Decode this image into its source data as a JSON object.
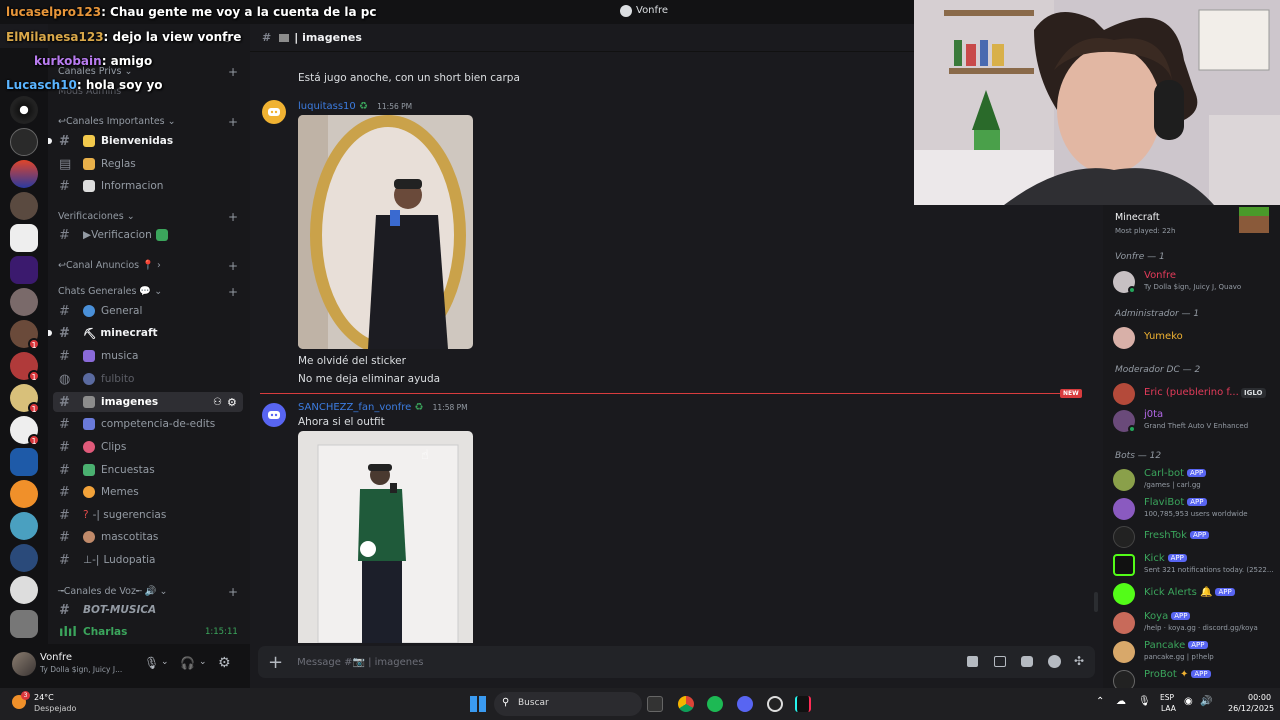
{
  "window": {
    "title": "Vonfre"
  },
  "overlay": [
    {
      "user": "lucaselpro123",
      "text": ": Chau gente me voy a la cuenta de la pc"
    },
    {
      "user": "ElMilanesa123",
      "text": ": dejo la view vonfre"
    },
    {
      "user": "kurkobain",
      "text": ": amigo"
    },
    {
      "user": "Lucasch10",
      "text": ": hola soy yo"
    }
  ],
  "server": {
    "name_partial": "Mods Admins"
  },
  "categories": {
    "privs": "Canales Privs",
    "importantes": "Canales Importantes",
    "verificaciones": "Verificaciones",
    "anuncios": "Canal Anuncios",
    "generales": "Chats Generales",
    "voz": "Canales de Voz"
  },
  "channels": [
    {
      "name": "Bienvenidas",
      "icon": "wave-icon",
      "style": "bold"
    },
    {
      "name": "Reglas",
      "icon": "scroll-icon",
      "style": ""
    },
    {
      "name": "Informacion",
      "icon": "page-icon",
      "style": ""
    },
    {
      "name": "▶Verificacion",
      "icon": "check-icon",
      "style": ""
    },
    {
      "name": "General",
      "icon": "globe-icon",
      "style": ""
    },
    {
      "name": "minecraft",
      "icon": "pickaxe-icon",
      "style": "bold"
    },
    {
      "name": "musica",
      "icon": "music-icon",
      "style": ""
    },
    {
      "name": "fulbito",
      "icon": "ball-icon",
      "style": "muted"
    },
    {
      "name": "imagenes",
      "icon": "camera-icon",
      "style": "active"
    },
    {
      "name": "competencia-de-edits",
      "icon": "film-icon",
      "style": ""
    },
    {
      "name": "Clips",
      "icon": "clip-icon",
      "style": ""
    },
    {
      "name": "Encuestas",
      "icon": "chart-icon",
      "style": ""
    },
    {
      "name": "Memes",
      "icon": "laugh-icon",
      "style": ""
    },
    {
      "name": "sugerencias",
      "icon": "question-icon",
      "style": ""
    },
    {
      "name": "mascotitas",
      "icon": "pet-icon",
      "style": ""
    },
    {
      "name": "Ludopatia",
      "icon": "dice-icon",
      "style": ""
    }
  ],
  "voice": {
    "bot": "BOT-MUSICA",
    "charlas": "Charlas",
    "time": "1:15:11"
  },
  "user_panel": {
    "name": "Vonfre",
    "status": "Ty Dolla $ign, Juicy J..."
  },
  "chat": {
    "channel": "imagenes",
    "messages": [
      {
        "text": "Está jugo anoche, con un short bien carpa"
      },
      {
        "user": "luquitass10",
        "time": "11:56 PM"
      },
      {
        "text": "Me olvidé del sticker"
      },
      {
        "text": "No me deja eliminar ayuda"
      },
      {
        "user": "SANCHEZZ_fan_vonfre",
        "time": "11:58 PM",
        "text": "Ahora si el outfit"
      }
    ],
    "new_label": "NEW",
    "placeholder": "Message #📷 | imagenes"
  },
  "members": {
    "top_game": "Minecraft",
    "top_game_sub": "Most played: 22h",
    "groups": [
      {
        "role": "Vonfre — 1"
      },
      {
        "role": "Administrador — 1"
      },
      {
        "role": "Moderador DC — 2"
      },
      {
        "role": "Bots — 12"
      }
    ],
    "list": [
      {
        "name": "Vonfre",
        "sub": "Ty Dolla $ign, Juicy J, Quavo",
        "color": "#e23b5a"
      },
      {
        "name": "Yumeko",
        "sub": "",
        "color": "#f0b232"
      },
      {
        "name": "Eric (pueblerino f...",
        "sub": "",
        "color": "#e23b5a",
        "tag": "IGLO"
      },
      {
        "name": "j0ta",
        "sub": "Grand Theft Auto V Enhanced",
        "color": "#b267e6"
      },
      {
        "name": "Carl-bot",
        "sub": "/games | carl.gg",
        "color": "#3ba55c",
        "app": "APP"
      },
      {
        "name": "FlaviBot",
        "sub": "100,785,953 users worldwide",
        "color": "#3ba55c",
        "app": "APP"
      },
      {
        "name": "FreshTok",
        "sub": "",
        "color": "#3ba55c",
        "app": "APP"
      },
      {
        "name": "Kick",
        "sub": "Sent 321 notifications today. (2522...",
        "color": "#3ba55c",
        "app": "APP"
      },
      {
        "name": "Kick Alerts",
        "sub": "",
        "color": "#3ba55c",
        "app": "APP"
      },
      {
        "name": "Koya",
        "sub": "/help · koya.gg · discord.gg/koya",
        "color": "#3ba55c",
        "app": "APP"
      },
      {
        "name": "Pancake",
        "sub": "pancake.gg | p!help",
        "color": "#3ba55c",
        "app": "APP"
      },
      {
        "name": "ProBot",
        "sub": "",
        "color": "#3ba55c",
        "app": "APP"
      }
    ]
  },
  "taskbar": {
    "weather_temp": "24°C",
    "weather_desc": "Despejado",
    "search": "Buscar",
    "lang1": "ESP",
    "lang2": "LAA",
    "time": "00:00",
    "date": "26/12/2025",
    "weather_badge": "3"
  }
}
